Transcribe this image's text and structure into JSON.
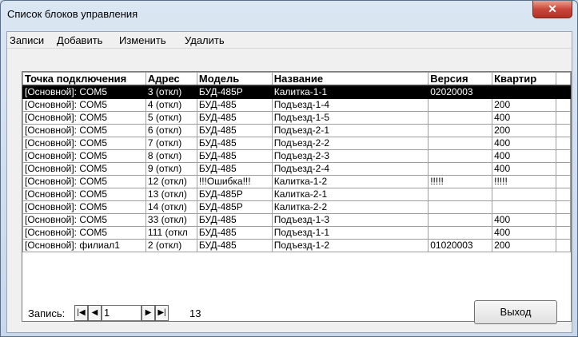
{
  "window": {
    "title": "Список блоков управления",
    "close_glyph": "✕"
  },
  "menu": [
    {
      "label": "Записи"
    },
    {
      "label": "Добавить"
    },
    {
      "label": "Изменить"
    },
    {
      "label": "Удалить"
    }
  ],
  "table": {
    "columns": [
      "Точка подключения",
      "Адрес",
      "Модель",
      "Название",
      "Версия",
      "Квартир"
    ],
    "selected_row": 0,
    "rows": [
      [
        "[Основной]: COM5",
        "3 (откл)",
        "БУД-485P",
        "Калитка-1-1",
        "02020003",
        ""
      ],
      [
        "[Основной]: COM5",
        "4 (откл)",
        "БУД-485",
        "Подъезд-1-4",
        "",
        "200"
      ],
      [
        "[Основной]: COM5",
        "5 (откл)",
        "БУД-485",
        "Подъезд-1-5",
        "",
        "400"
      ],
      [
        "[Основной]: COM5",
        "6 (откл)",
        "БУД-485",
        "Подъезд-2-1",
        "",
        "200"
      ],
      [
        "[Основной]: COM5",
        "7 (откл)",
        "БУД-485",
        "Подъезд-2-2",
        "",
        "400"
      ],
      [
        "[Основной]: COM5",
        "8 (откл)",
        "БУД-485",
        "Подъезд-2-3",
        "",
        "400"
      ],
      [
        "[Основной]: COM5",
        "9 (откл)",
        "БУД-485",
        "Подъезд-2-4",
        "",
        "400"
      ],
      [
        "[Основной]: COM5",
        "12 (откл)",
        "!!!Ошибка!!!",
        "Калитка-1-2",
        "!!!!!",
        "!!!!!"
      ],
      [
        "[Основной]: COM5",
        "13 (откл)",
        "БУД-485P",
        "Калитка-2-1",
        "",
        ""
      ],
      [
        "[Основной]: COM5",
        "14 (откл)",
        "БУД-485P",
        "Калитка-2-2",
        "",
        ""
      ],
      [
        "[Основной]: COM5",
        "33 (откл)",
        "БУД-485",
        "Подъезд-1-3",
        "",
        "400"
      ],
      [
        "[Основной]: COM5",
        "111 (откл",
        "БУД-485",
        "Подъезд-1-1",
        "",
        "400"
      ],
      [
        "[Основной]: филиал1",
        "2 (откл)",
        "БУД-485",
        "Подъезд-1-2",
        "01020003",
        "200"
      ]
    ]
  },
  "footer": {
    "record_label": "Запись:",
    "record_value": "1",
    "record_count": "13",
    "exit_label": "Выход",
    "nav_icons": [
      "first-record-icon",
      "prev-record-icon",
      "next-record-icon",
      "last-record-icon"
    ]
  },
  "colors": {
    "selection_bg": "#000000",
    "selection_fg": "#ffffff",
    "close_button": "#c9473a"
  }
}
